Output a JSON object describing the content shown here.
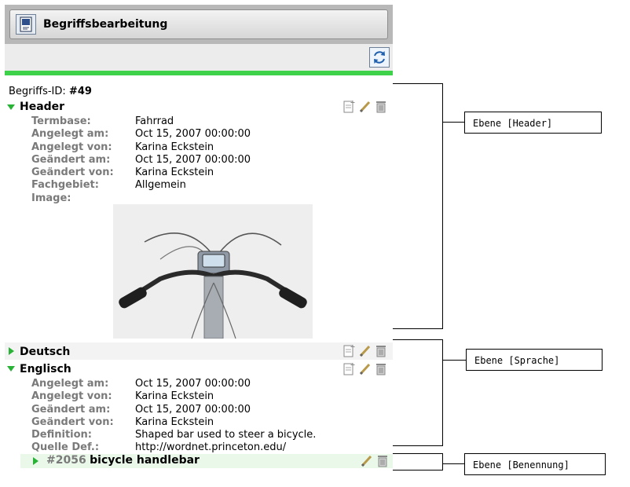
{
  "window": {
    "title": "Begriffsbearbeitung",
    "app_icon": "app-book-icon",
    "refresh_icon": "refresh-icon"
  },
  "concept": {
    "id_label": "Begriffs-ID:",
    "id_value": "#49"
  },
  "header": {
    "title": "Header",
    "fields": [
      {
        "key": "Termbase:",
        "value": "Fahrrad"
      },
      {
        "key": "Angelegt am:",
        "value": "Oct 15, 2007 00:00:00"
      },
      {
        "key": "Angelegt von:",
        "value": "Karina Eckstein"
      },
      {
        "key": "Geändert am:",
        "value": "Oct 15, 2007 00:00:00"
      },
      {
        "key": "Geändert von:",
        "value": "Karina Eckstein"
      },
      {
        "key": "Fachgebiet:",
        "value": "Allgemein"
      },
      {
        "key": "Image:",
        "value": ""
      }
    ]
  },
  "languages": [
    {
      "name": "Deutsch",
      "expanded": false
    },
    {
      "name": "Englisch",
      "expanded": true,
      "fields": [
        {
          "key": "Angelegt am:",
          "value": "Oct 15, 2007 00:00:00"
        },
        {
          "key": "Angelegt von:",
          "value": "Karina Eckstein"
        },
        {
          "key": "Geändert am:",
          "value": "Oct 15, 2007 00:00:00"
        },
        {
          "key": "Geändert von:",
          "value": "Karina Eckstein"
        },
        {
          "key": "Definition:",
          "value": "Shaped bar used to steer a bicycle."
        },
        {
          "key": "Quelle Def.:",
          "value": "http://wordnet.princeton.edu/"
        }
      ]
    }
  ],
  "term": {
    "id": "#2056",
    "name": "bicycle handlebar"
  },
  "annotations": [
    {
      "label": "Ebene [Header]"
    },
    {
      "label": "Ebene [Sprache]"
    },
    {
      "label": "Ebene [Benennung]"
    }
  ],
  "colors": {
    "accent_green": "#3dd24a",
    "toggle_green": "#28b236",
    "label_grey": "#7a7a7a"
  }
}
